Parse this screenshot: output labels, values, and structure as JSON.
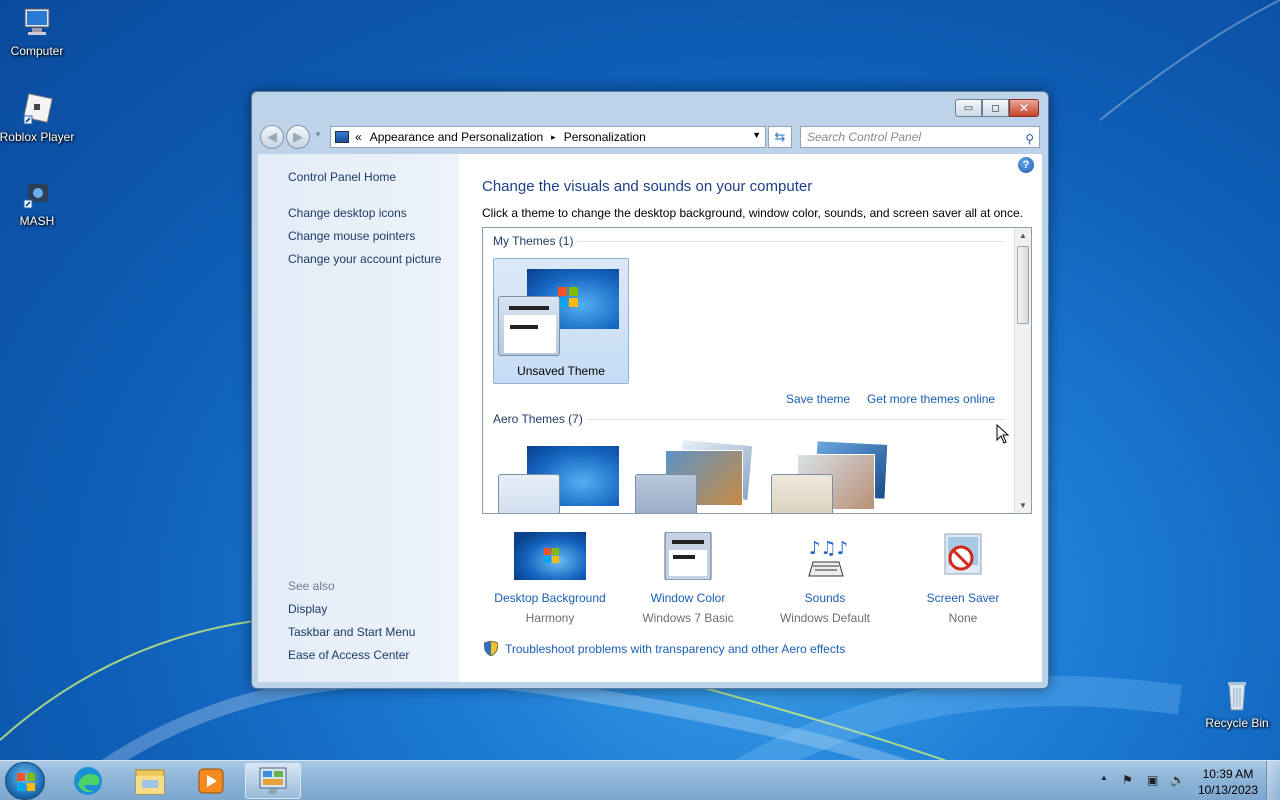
{
  "desktop": {
    "icons": [
      {
        "label": "Computer"
      },
      {
        "label": "Roblox Player"
      },
      {
        "label": "MASH"
      },
      {
        "label": "Recycle Bin"
      }
    ]
  },
  "window": {
    "controls": {
      "minimize": "▭",
      "maximize": "◻",
      "close": "✕"
    },
    "breadcrumb": {
      "prefix": "«",
      "items": [
        "Appearance and Personalization",
        "Personalization"
      ],
      "separator": "▸"
    },
    "search_placeholder": "Search Control Panel",
    "help": "?"
  },
  "left_pane": {
    "home": "Control Panel Home",
    "links": [
      "Change desktop icons",
      "Change mouse pointers",
      "Change your account picture"
    ],
    "see_also_heading": "See also",
    "see_also": [
      "Display",
      "Taskbar and Start Menu",
      "Ease of Access Center"
    ]
  },
  "main": {
    "title": "Change the visuals and sounds on your computer",
    "description": "Click a theme to change the desktop background, window color, sounds, and screen saver all at once.",
    "my_themes_heading": "My Themes (1)",
    "selected_theme": "Unsaved Theme",
    "save_theme": "Save theme",
    "more_themes": "Get more themes online",
    "aero_themes_heading": "Aero Themes (7)",
    "settings": [
      {
        "name": "Desktop Background",
        "value": "Harmony"
      },
      {
        "name": "Window Color",
        "value": "Windows 7 Basic"
      },
      {
        "name": "Sounds",
        "value": "Windows Default"
      },
      {
        "name": "Screen Saver",
        "value": "None"
      }
    ],
    "troubleshoot": "Troubleshoot problems with transparency and other Aero effects"
  },
  "taskbar": {
    "clock_time": "10:39 AM",
    "clock_date": "10/13/2023",
    "tray_arrow": "▲"
  }
}
